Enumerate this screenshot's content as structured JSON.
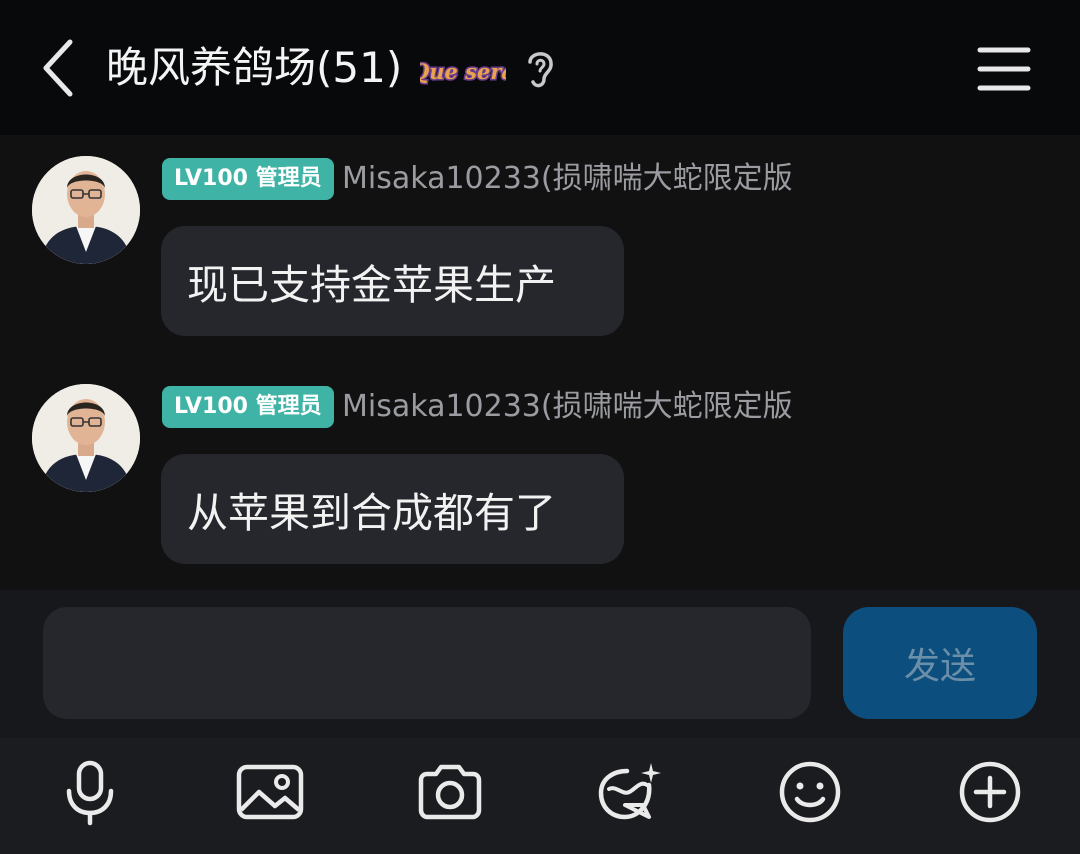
{
  "header": {
    "title": "晚风养鸽场(51)",
    "badge_text": "Que sera",
    "back_icon": "chevron-left-icon",
    "ear_icon": "ear-icon",
    "menu_icon": "hamburger-menu-icon"
  },
  "messages": [
    {
      "level": "LV100 管理员",
      "username": "Misaka10233(损啸喘大蛇限定版",
      "text": "现已支持金苹果生产"
    },
    {
      "level": "LV100 管理员",
      "username": "Misaka10233(损啸喘大蛇限定版",
      "text": "从苹果到合成都有了"
    }
  ],
  "composer": {
    "input_value": "",
    "send_label": "发送"
  },
  "toolbar": {
    "items": [
      "microphone-icon",
      "image-icon",
      "camera-icon",
      "sticker-icon",
      "emoji-icon",
      "plus-icon"
    ]
  },
  "colors": {
    "header_bg": "#08090b",
    "chat_bg": "#111112",
    "bubble_bg": "#25272c",
    "level_badge": "#3fb3a6",
    "send_button": "#0c4f7e"
  }
}
